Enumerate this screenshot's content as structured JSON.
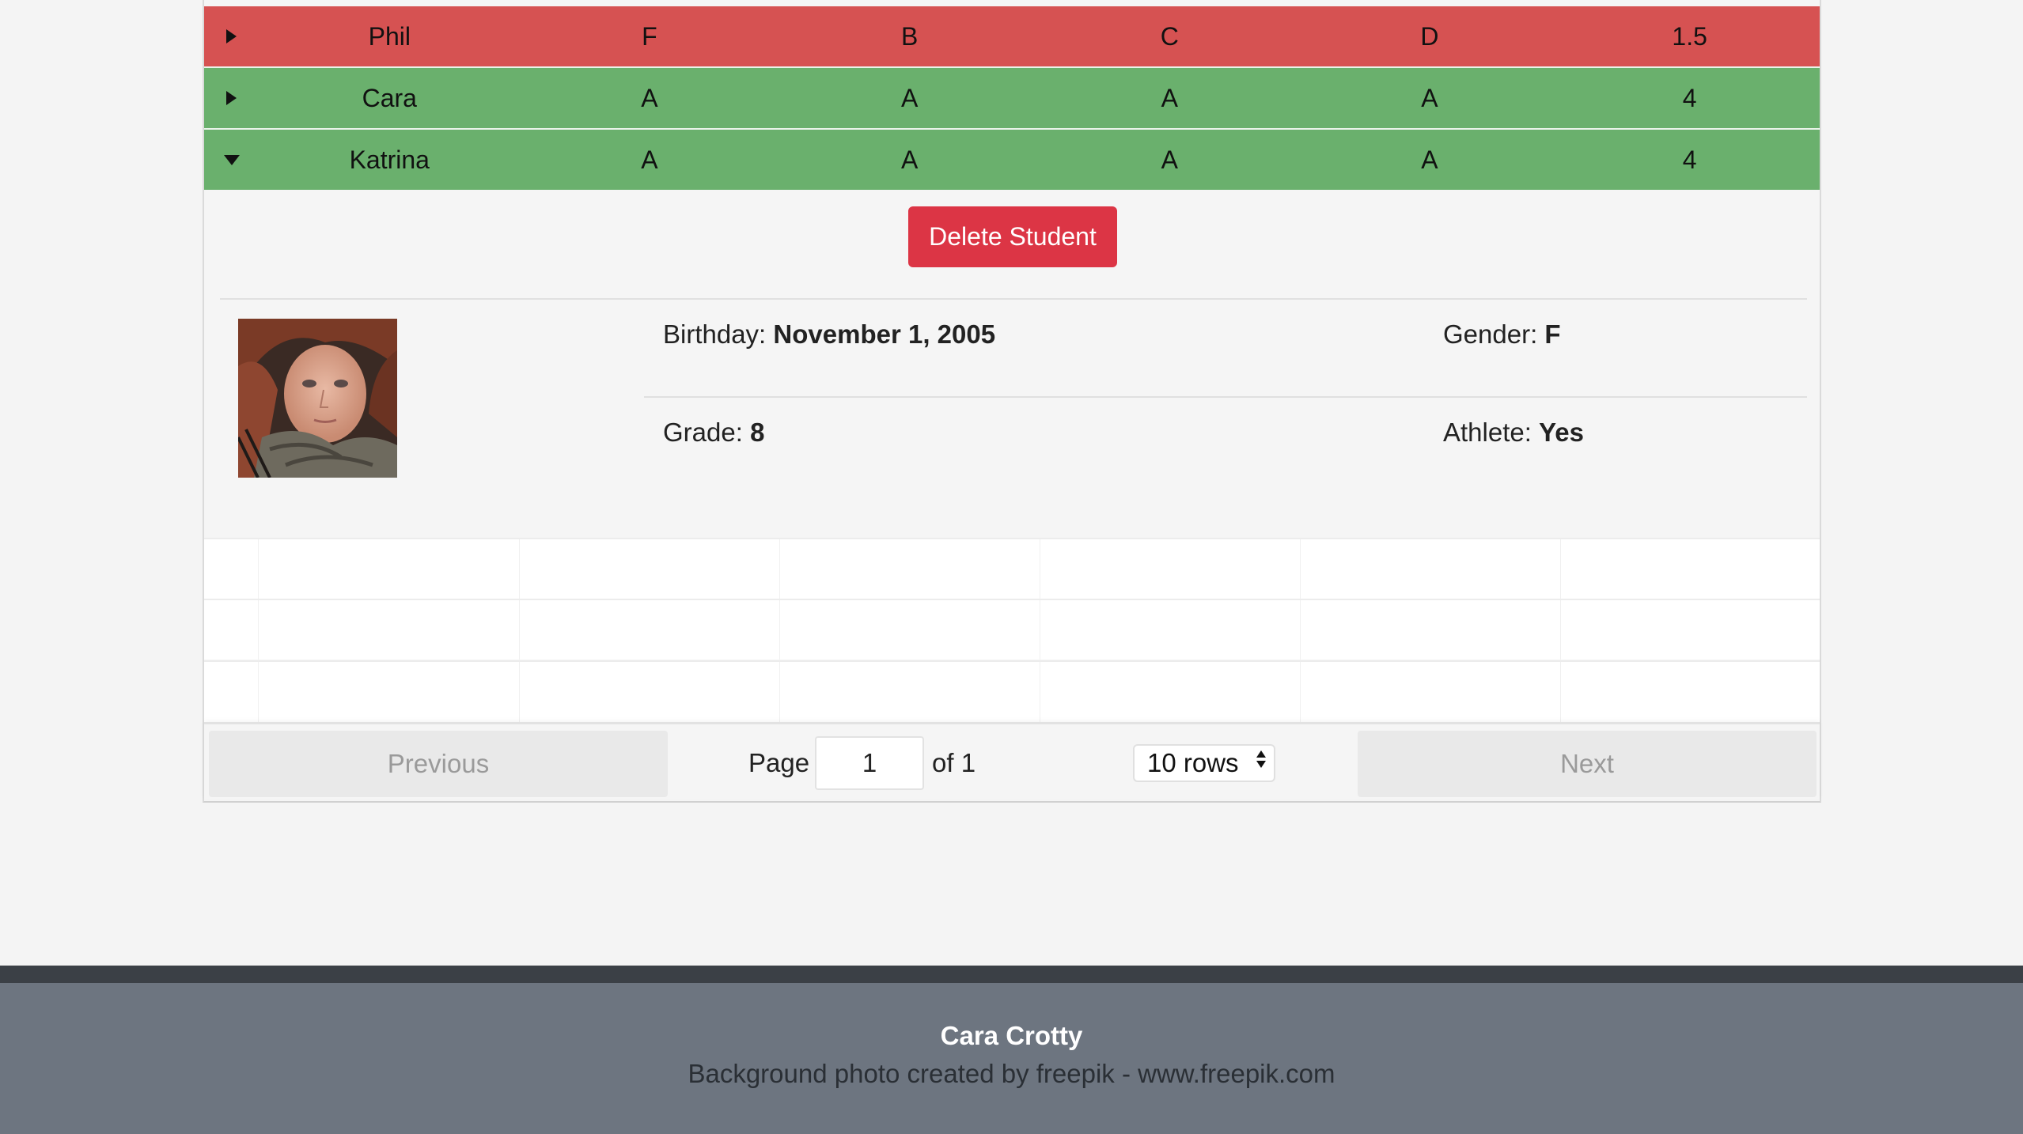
{
  "students": [
    {
      "name": "Phil",
      "grades": [
        "F",
        "B",
        "C",
        "D"
      ],
      "gpa": "1.5",
      "status": "red",
      "expanded": false
    },
    {
      "name": "Cara",
      "grades": [
        "A",
        "A",
        "A",
        "A"
      ],
      "gpa": "4",
      "status": "green",
      "expanded": false
    },
    {
      "name": "Katrina",
      "grades": [
        "A",
        "A",
        "A",
        "A"
      ],
      "gpa": "4",
      "status": "green",
      "expanded": true
    }
  ],
  "colors": {
    "fail_row": "#d65252",
    "pass_row": "#6ab06d",
    "danger": "#dc3545"
  },
  "detail": {
    "delete_label": "Delete Student",
    "birthday_label": "Birthday:",
    "birthday_value": "November 1, 2005",
    "gender_label": "Gender:",
    "gender_value": "F",
    "grade_label": "Grade:",
    "grade_value": "8",
    "athlete_label": "Athlete:",
    "athlete_value": "Yes"
  },
  "pagination": {
    "previous_label": "Previous",
    "page_label": "Page",
    "page_value": "1",
    "of_label": "of 1",
    "rows_label": "10 rows",
    "next_label": "Next"
  },
  "footer": {
    "name": "Cara Crotty",
    "credit": "Background photo created by freepik - www.freepik.com"
  }
}
